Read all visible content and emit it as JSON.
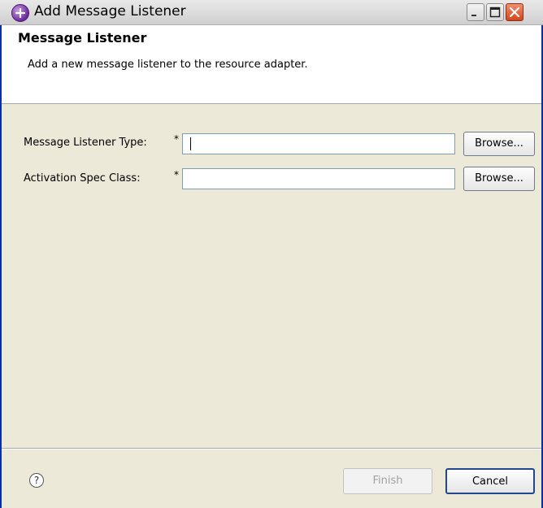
{
  "window": {
    "title": "Add Message Listener",
    "icon": "wizard-icon",
    "controls": [
      "minimize",
      "maximize",
      "close"
    ]
  },
  "header": {
    "title": "Message Listener",
    "description": "Add a new message listener to the resource adapter."
  },
  "form": {
    "fields": [
      {
        "label": "Message Listener Type:",
        "required_marker": "*",
        "value": "",
        "browse_label": "Browse..."
      },
      {
        "label": "Activation Spec Class:",
        "required_marker": "*",
        "value": "",
        "browse_label": "Browse..."
      }
    ]
  },
  "footer": {
    "help_icon": "help-icon",
    "help_glyph": "?",
    "finish_label": "Finish",
    "finish_enabled": false,
    "cancel_label": "Cancel"
  },
  "colors": {
    "dialog_bg": "#ece9d8",
    "header_bg": "#ffffff",
    "field_border": "#7f9db9",
    "disabled_text": "#a0a0a0"
  }
}
